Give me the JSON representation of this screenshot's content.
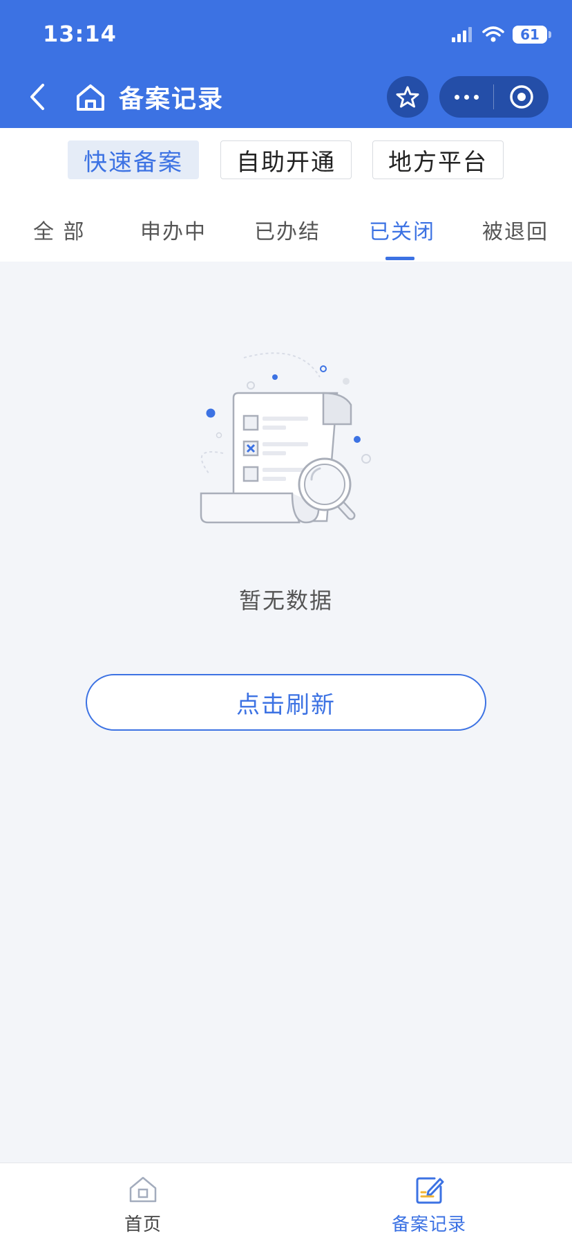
{
  "status_bar": {
    "time": "13:14",
    "battery": "61"
  },
  "nav": {
    "title": "备案记录"
  },
  "segments": [
    {
      "label": "快速备案",
      "active": true
    },
    {
      "label": "自助开通",
      "active": false
    },
    {
      "label": "地方平台",
      "active": false
    }
  ],
  "tabs": [
    {
      "label": "全 部",
      "active": false
    },
    {
      "label": "申办中",
      "active": false
    },
    {
      "label": "已办结",
      "active": false
    },
    {
      "label": "已关闭",
      "active": true
    },
    {
      "label": "被退回",
      "active": false
    }
  ],
  "empty": {
    "message": "暂无数据",
    "refresh_label": "点击刷新"
  },
  "tabbar": [
    {
      "label": "首页",
      "icon": "home-icon",
      "active": false
    },
    {
      "label": "备案记录",
      "icon": "edit-record-icon",
      "active": true
    }
  ],
  "colors": {
    "primary": "#3c72e3",
    "capsule": "#244ea8",
    "background": "#f3f5f9"
  }
}
